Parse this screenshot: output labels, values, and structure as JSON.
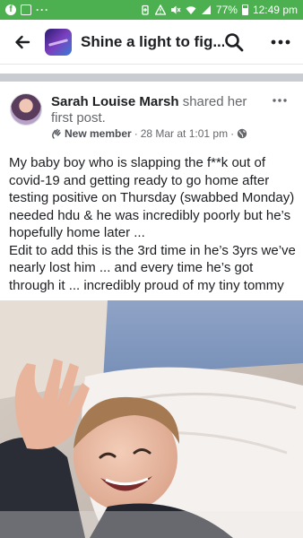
{
  "status_bar": {
    "time": "12:49 pm",
    "battery": "77%",
    "left_icons": [
      "facebook-icon",
      "image-icon",
      "more-dots-icon"
    ],
    "right_icons": [
      "battery-saver-icon",
      "alert-icon",
      "mute-icon",
      "wifi-icon",
      "signal-icon",
      "battery-icon"
    ]
  },
  "header": {
    "group_title": "Shine a light to fig...",
    "icons": [
      "back-arrow-icon",
      "search-icon",
      "more-icon"
    ]
  },
  "post": {
    "author": "Sarah Louise Marsh",
    "action": "shared her first post.",
    "badge": "New member",
    "meta_separator": "·",
    "timestamp": "28 Mar at 1:01 pm",
    "audience_icon": "globe-icon",
    "badge_icon": "wave-hand-icon",
    "paragraphs": [
      "My baby boy who is slapping the f**k out of covid-19 and getting ready to go home after testing positive on Thursday (swabbed Monday) needed hdu & he was incredibly poorly but he’s hopefully home later ...",
      "Edit to add this is the 3rd time in he’s 3yrs we’ve nearly lost him ... and every time he’s got through it ... incredibly proud of my tiny tommy"
    ]
  },
  "colors": {
    "status_bar": "#4caf50",
    "separator": "#c9ccd1",
    "secondary_text": "#65676b"
  }
}
